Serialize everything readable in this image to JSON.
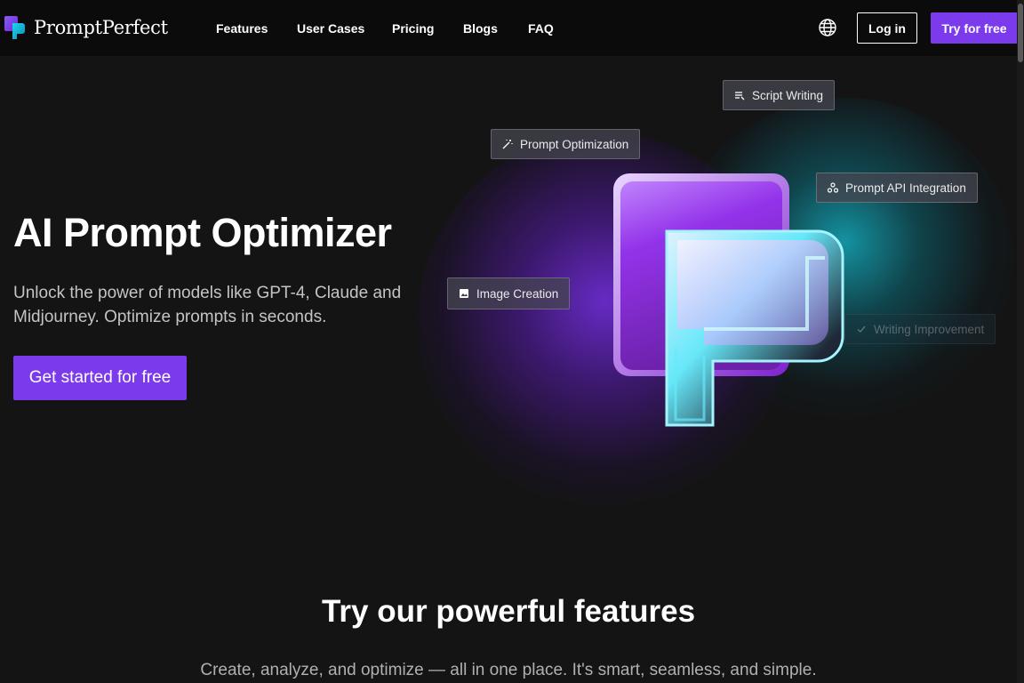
{
  "brand": {
    "name": "PromptPerfect"
  },
  "nav": {
    "links": [
      {
        "label": "Features"
      },
      {
        "label": "User Cases"
      },
      {
        "label": "Pricing"
      },
      {
        "label": "Blogs"
      },
      {
        "label": "FAQ"
      }
    ],
    "login_label": "Log in",
    "try_label": "Try for free",
    "globe_icon": "globe-icon"
  },
  "hero": {
    "title": "AI Prompt Optimizer",
    "subtitle": "Unlock the power of models like GPT-4, Claude and Midjourney. Optimize prompts in seconds.",
    "cta_label": "Get started for free",
    "chips": [
      {
        "label": "Script Writing",
        "icon": "lines-icon"
      },
      {
        "label": "Prompt Optimization",
        "icon": "magic-wand-icon"
      },
      {
        "label": "Prompt API Integration",
        "icon": "api-nodes-icon"
      },
      {
        "label": "Image Creation",
        "icon": "image-icon"
      },
      {
        "label": "Writing Improvement",
        "icon": "check-icon"
      }
    ]
  },
  "features": {
    "title": "Try our powerful features",
    "subtitle": "Create, analyze, and optimize — all in one place. It's smart, seamless, and simple."
  },
  "colors": {
    "accent": "#7c3aed",
    "background": "#141414",
    "nav_background": "#0b0b0b"
  }
}
